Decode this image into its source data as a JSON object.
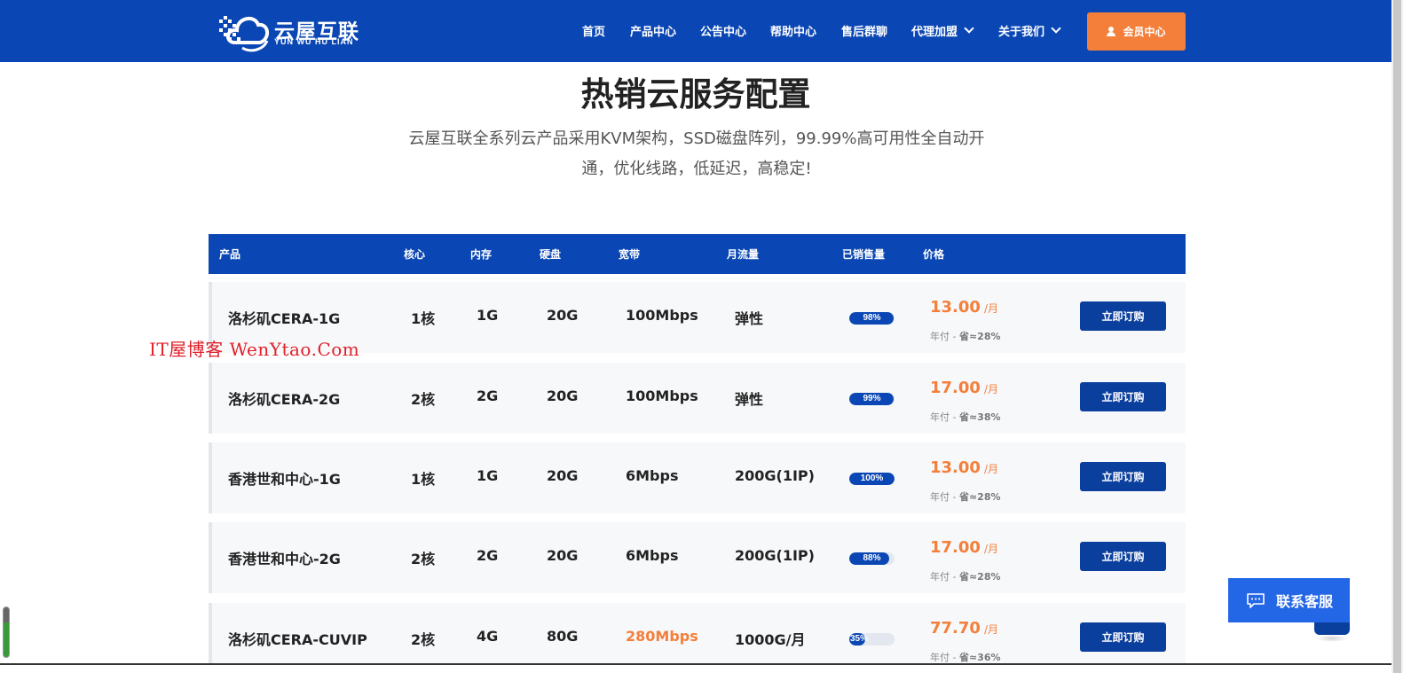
{
  "header": {
    "logo_cn": "云屋互联",
    "logo_en": "YUN WU HU LIAN",
    "nav": [
      "首页",
      "产品中心",
      "公告中心",
      "帮助中心",
      "售后群聊",
      "代理加盟",
      "关于我们"
    ],
    "member_button": "会员中心"
  },
  "hero": {
    "title": "热销云服务配置",
    "desc_line1": "云屋互联全系列云产品采用KVM架构，SSD磁盘阵列，99.99%高可用性全自动开",
    "desc_line2": "通，优化线路，低延迟，高稳定!"
  },
  "watermark": "IT屋博客 WenYtao.Com",
  "table": {
    "headers": [
      "产品",
      "核心",
      "内存",
      "硬盘",
      "宽带",
      "月流量",
      "已销售量",
      "价格"
    ],
    "rows": [
      {
        "name": "洛杉矶CERA-1G",
        "cores": "1核",
        "ram": "1G",
        "disk": "20G",
        "bandwidth": "100Mbps",
        "traffic": "弹性",
        "sold": 0.98,
        "sold_label": "98%",
        "price": "13.00",
        "unit": "/月",
        "yearly": "年付 -",
        "save": "省≈28%",
        "button": "立即订购"
      },
      {
        "name": "洛杉矶CERA-2G",
        "cores": "2核",
        "ram": "2G",
        "disk": "20G",
        "bandwidth": "100Mbps",
        "traffic": "弹性",
        "sold": 0.99,
        "sold_label": "99%",
        "price": "17.00",
        "unit": "/月",
        "yearly": "年付 -",
        "save": "省≈38%",
        "button": "立即订购"
      },
      {
        "name": "香港世和中心-1G",
        "cores": "1核",
        "ram": "1G",
        "disk": "20G",
        "bandwidth": "6Mbps",
        "traffic": "200G(1IP)",
        "sold": 1.0,
        "sold_label": "100%",
        "price": "13.00",
        "unit": "/月",
        "yearly": "年付 -",
        "save": "省≈28%",
        "button": "立即订购"
      },
      {
        "name": "香港世和中心-2G",
        "cores": "2核",
        "ram": "2G",
        "disk": "20G",
        "bandwidth": "6Mbps",
        "traffic": "200G(1IP)",
        "sold": 0.88,
        "sold_label": "88%",
        "price": "17.00",
        "unit": "/月",
        "yearly": "年付 -",
        "save": "省≈28%",
        "button": "立即订购"
      },
      {
        "name": "洛杉矶CERA-CUVIP",
        "cores": "2核",
        "ram": "4G",
        "disk": "80G",
        "bandwidth": "280Mbps",
        "traffic": "1000G/月",
        "sold": 0.35,
        "sold_label": "35%",
        "price": "77.70",
        "unit": "/月",
        "yearly": "年付 -",
        "save": "省≈36%",
        "button": "立即订购"
      }
    ]
  },
  "contact": {
    "label": "联系客服"
  },
  "colors": {
    "brand": "#0b47b4",
    "accent": "#f47f3a",
    "button": "#0b3f9e",
    "contact": "#2366e6"
  }
}
